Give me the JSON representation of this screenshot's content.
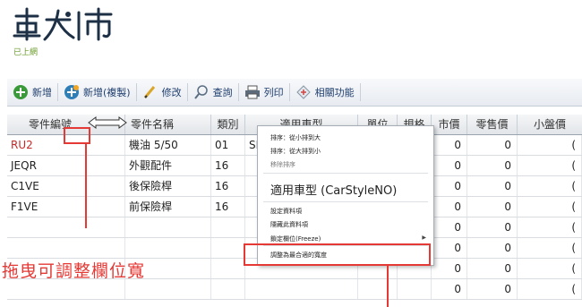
{
  "app": {
    "logo_text": "車大師",
    "logo_sub": "已上網"
  },
  "toolbar": {
    "buttons": [
      {
        "label": "新增",
        "icon": "green-plus-icon"
      },
      {
        "label": "新增(複製)",
        "icon": "add-copy-icon"
      },
      {
        "label": "修改",
        "icon": "pencil-icon"
      },
      {
        "label": "查詢",
        "icon": "magnifier-icon"
      },
      {
        "label": "列印",
        "icon": "printer-icon"
      },
      {
        "label": "相關功能",
        "icon": "related-functions-icon"
      }
    ]
  },
  "grid": {
    "columns": [
      "零件編號",
      "零件名稱",
      "類別",
      "適用車型",
      "單位",
      "規格",
      "市價",
      "零售價",
      "小盤價"
    ],
    "rows": [
      {
        "code": "RU2",
        "name": "機油 5/50",
        "cat": "01",
        "car": "SI",
        "price": "0",
        "retail": "0",
        "sub": "("
      },
      {
        "code": "JEQR",
        "name": "外觀配件",
        "cat": "16",
        "car": "",
        "price": "0",
        "retail": "0",
        "sub": "("
      },
      {
        "code": "C1VE",
        "name": "後保險桿",
        "cat": "16",
        "car": "",
        "price": "0",
        "retail": "0",
        "sub": "("
      },
      {
        "code": "F1VE",
        "name": "前保險桿",
        "cat": "16",
        "car": "",
        "price": "0",
        "retail": "0",
        "sub": "("
      },
      {
        "code": "",
        "name": "",
        "cat": "",
        "car": "",
        "price": "0",
        "retail": "0",
        "sub": "("
      },
      {
        "code": "",
        "name": "",
        "cat": "",
        "car": "",
        "price": "0",
        "retail": "0",
        "sub": "("
      },
      {
        "code": "",
        "name": "",
        "cat": "",
        "car": "",
        "price": "0",
        "retail": "0",
        "sub": "("
      },
      {
        "code": "",
        "name": "",
        "cat": "",
        "car": "",
        "price": "0",
        "retail": "0",
        "sub": "("
      }
    ]
  },
  "context_menu": {
    "sort_asc": "排序：從小排到大",
    "sort_desc": "排序：從大排到小",
    "remove_sort": "移除排序",
    "column_title": "適用車型 (CarStyleNO)",
    "set_columns": "設定資料項",
    "hide_column": "隱藏此資料項",
    "freeze": "鎖定欄位(Freeze)",
    "auto_fit": "調整為最合適的寬度"
  },
  "annotation": {
    "text": "拖曳可調整欄位寬"
  },
  "colors": {
    "annotation": "#e53935",
    "toolbar_text": "#1f3e6e",
    "first_row_code": "#c62828"
  }
}
